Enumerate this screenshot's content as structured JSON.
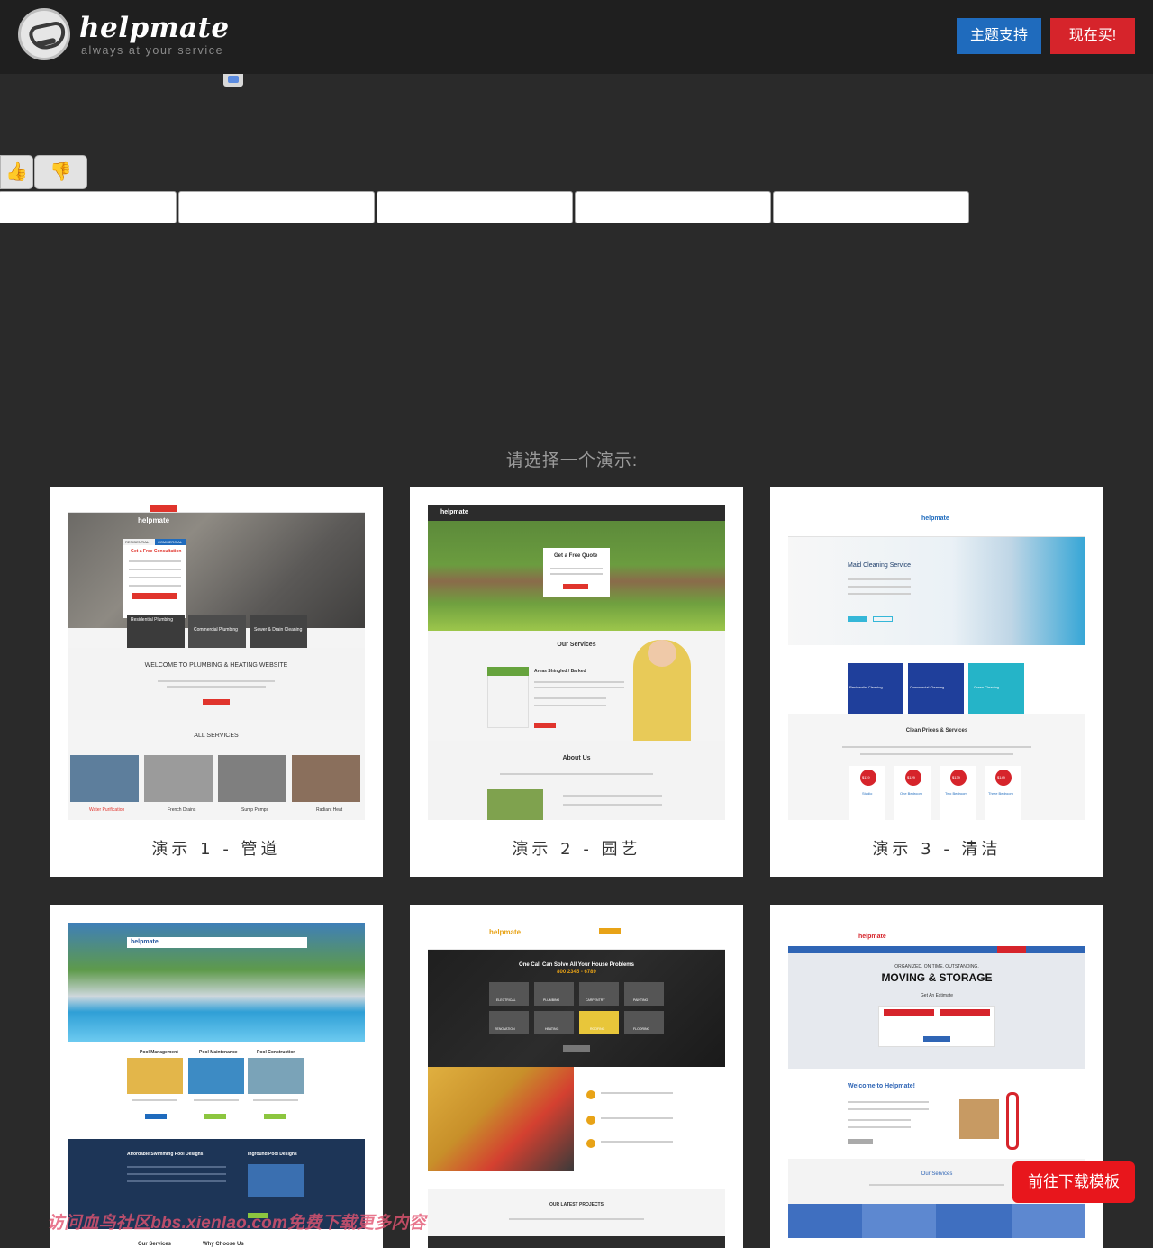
{
  "header": {
    "brand_name": "helpmate",
    "brand_tagline": "always at your service",
    "support_button": "主题支持",
    "buy_button": "现在买!"
  },
  "rating": {
    "up_icon": "thumbs-up-icon",
    "down_icon": "thumbs-down-icon"
  },
  "demo_section": {
    "title": "请选择一个演示:",
    "demos": [
      {
        "label": "演示 1 - 管道",
        "preview": {
          "hero_title": "Get a Free Consultation",
          "hero_tabs": [
            "RESIDENTIAL",
            "COMMERCIAL"
          ],
          "hero_services": [
            "Residential Plumbing",
            "Commercial Plumbing",
            "Sewer & Drain Cleaning"
          ],
          "welcome": "WELCOME TO PLUMBING & HEATING WEBSITE",
          "services_title": "ALL SERVICES",
          "services": [
            "Water Purification",
            "French Drains",
            "Sump Pumps",
            "Radiant Heat"
          ]
        }
      },
      {
        "label": "演示 2 - 园艺",
        "preview": {
          "hero_box": "Get a Free Quote",
          "services_title": "Our Services",
          "service_item": "Areas Shingled / Barked",
          "about_title": "About Us"
        }
      },
      {
        "label": "演示 3 - 清洁",
        "preview": {
          "hero_title": "Maid Cleaning Service",
          "tiles": [
            "Residential Cleaning",
            "Commercial Cleaning",
            "Green Cleaning"
          ],
          "prices_title": "Clean Prices & Services",
          "prices": [
            "$119",
            "$129",
            "$139",
            "$149"
          ],
          "plans": [
            "Studio",
            "One Bedroom",
            "Two Bedroom",
            "Three Bedroom"
          ]
        }
      },
      {
        "label": "",
        "preview": {
          "columns": [
            "Pool Management",
            "Pool Maintenance",
            "Pool Construction"
          ],
          "band_left": "Affordable Swimming Pool Designs",
          "band_right": "Inground Pool Designs",
          "footer_left": "Our Services",
          "footer_right": "Why Choose Us"
        }
      },
      {
        "label": "",
        "preview": {
          "hero_title": "One Call Can Solve All Your House Problems",
          "phone": "800 2345 - 6789",
          "tiles": [
            "ELECTRICAL",
            "PLUMBING",
            "CARPENTRY",
            "PAINTING",
            "RENOVATION",
            "HEATING",
            "ROOFING",
            "FLOORING"
          ],
          "projects_title": "OUR LATEST PROJECTS"
        }
      },
      {
        "label": "",
        "preview": {
          "hero_sub": "ORGANIZED. ON TIME. OUTSTANDING.",
          "hero_title": "MOVING & STORAGE",
          "estimate": "Get An Estimate",
          "welcome": "Welcome to Helpmate!",
          "services_title": "Our Services"
        }
      }
    ]
  },
  "watermark": "访问血鸟社区bbs.xienlao.com免费下载更多内容",
  "download_button": "前往下载模板"
}
